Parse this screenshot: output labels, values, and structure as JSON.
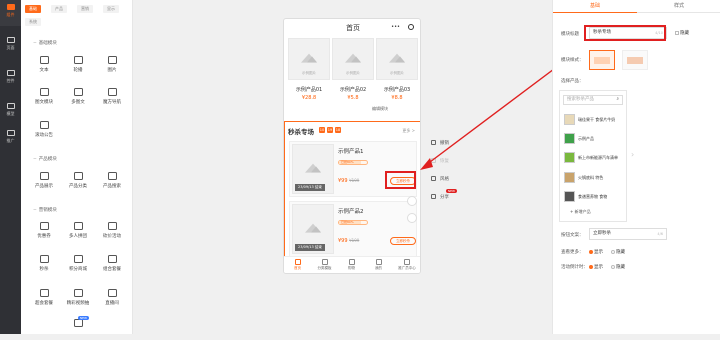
{
  "rail": [
    {
      "label": "组件"
    },
    {
      "label": "页面"
    },
    {
      "label": "控件"
    },
    {
      "label": "模型"
    },
    {
      "label": "推广"
    }
  ],
  "modules": {
    "tabs": [
      "基础",
      "产品",
      "营销",
      "显示"
    ],
    "tab_row2": "系统",
    "sections": {
      "basic": {
        "title": "基础模块",
        "items": [
          "文本",
          "轮播",
          "图片",
          "图文模块",
          "多图文",
          "魔方导航",
          "滚动公告"
        ]
      },
      "product": {
        "title": "产品模块",
        "items": [
          "产品展示",
          "产品分类",
          "产品搜索"
        ]
      },
      "marketing": {
        "title": "营销模块",
        "items": [
          "优惠券",
          "多人拼团",
          "砍价活动",
          "秒杀",
          "积分商城",
          "组合套餐",
          "超会套餐",
          "精彩视频抽",
          "直播间"
        ]
      }
    },
    "new_badge": "NEW"
  },
  "phone": {
    "title": "首页",
    "dots": "•••",
    "products": [
      {
        "img": "示例图片",
        "name": "示例产品01",
        "price": "¥28.8"
      },
      {
        "img": "示例图片",
        "name": "示例产品02",
        "price": "¥5.8"
      },
      {
        "img": "示例图片",
        "name": "示例产品03",
        "price": "¥8.8"
      }
    ],
    "edit_tip": "编辑模块",
    "seckill": {
      "title": "秒杀专场",
      "countdown": [
        "10",
        "19",
        "18"
      ],
      "more": "更多 >",
      "cards": [
        {
          "name": "示例产品1",
          "sold": "已抢80%",
          "progress": 0.8,
          "price": "¥99",
          "old_price": "¥199",
          "date": "23/09/13 结束",
          "btn": "立即秒杀"
        },
        {
          "name": "示例产品2",
          "sold": "已抢80%",
          "progress": 0.8,
          "price": "¥99",
          "old_price": "¥199",
          "date": "23/09/13 结束",
          "btn": "立即秒杀"
        }
      ]
    },
    "nav": [
      "首页",
      "分类模板",
      "购物",
      "我的",
      "推广员中心"
    ]
  },
  "actions": {
    "undo": "撤销",
    "redo": "恢复",
    "style": "风格",
    "share": "分享",
    "new": "NEW"
  },
  "right": {
    "tabs": [
      "基础",
      "样式"
    ],
    "module_title_label": "模块标题",
    "module_title_value": "秒杀专场",
    "module_title_count": "4/10",
    "hide_label": "隐藏",
    "style_label": "模块样式：",
    "select_products_label": "选择产品：",
    "search_placeholder": "搜索秒杀产品",
    "product_list": [
      "瑞佳果干 食保片牛奶",
      "示例产品",
      "新上市新能源汽车清单",
      "火锅底料 特色",
      "食谱营养物 食物"
    ],
    "add_product": "+ 新增产品",
    "btn_text_label": "按钮文案：",
    "btn_text_value": "立即秒杀",
    "btn_text_count": "4/6",
    "show_more_label": "查看更多：",
    "show_label": "显示",
    "hide2_label": "隐藏",
    "countdown_label": "活动倒计时：",
    "show3_label": "显示",
    "hide3_label": "隐藏"
  },
  "colors": {
    "accent": "#ff6a1a",
    "highlight": "#e02020"
  }
}
